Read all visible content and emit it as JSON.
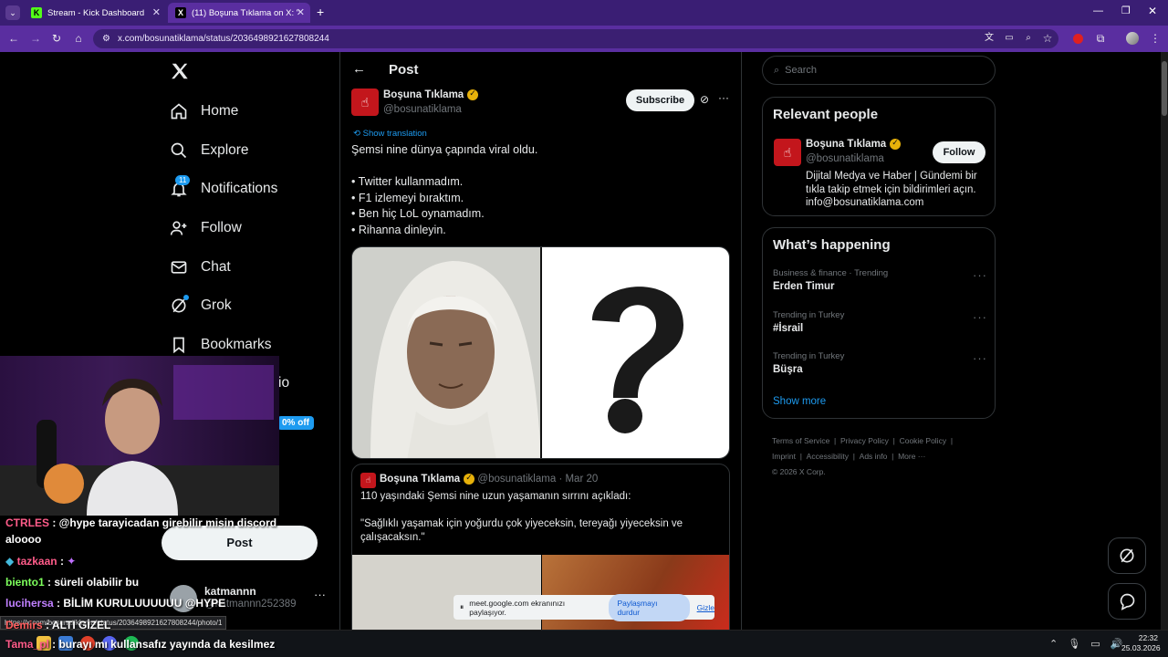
{
  "browser": {
    "tabs": [
      {
        "label": "Stream - Kick Dashboard",
        "favicon": "K"
      },
      {
        "label": "(11) Boşuna Tıklama on X: \"Şem",
        "favicon": "X"
      }
    ],
    "new_tab": "+",
    "url": "x.com/bosunatiklama/status/2036498921627808244"
  },
  "sidebar": {
    "items": [
      {
        "label": "Home",
        "icon": "home-icon"
      },
      {
        "label": "Explore",
        "icon": "search-icon"
      },
      {
        "label": "Notifications",
        "icon": "bell-icon",
        "badge": "11"
      },
      {
        "label": "Follow",
        "icon": "follow-icon"
      },
      {
        "label": "Chat",
        "icon": "mail-icon"
      },
      {
        "label": "Grok",
        "icon": "grok-icon"
      },
      {
        "label": "Bookmarks",
        "icon": "bookmark-icon"
      }
    ],
    "partial_label": "io",
    "partial_badge": "0% off",
    "post_button": "Post",
    "account": {
      "name": "katmannn",
      "handle": "@katmannn252389"
    }
  },
  "post": {
    "header": "Post",
    "author": "Boşuna Tıklama",
    "handle": "@bosunatiklama",
    "subscribe": "Subscribe",
    "show_translation": "Show translation",
    "lines": [
      "Şemsi nine dünya çapında viral oldu.",
      "",
      "• Twitter kullanmadım.",
      "• F1 izlemeyi bıraktım.",
      "• Ben hiç LoL oynamadım.",
      "• Rihanna dinleyin."
    ],
    "quote": {
      "author": "Boşuna Tıklama",
      "handle": "@bosunatiklama",
      "date": "· Mar 20",
      "line1": "110 yaşındaki Şemsi nine uzun yaşamanın sırrını açıkladı:",
      "line2": "\"Sağlıklı yaşamak için yoğurdu çok yiyeceksin, tereyağı yiyeceksin ve",
      "line3": "çalışacaksın.\""
    }
  },
  "right": {
    "search_placeholder": "Search",
    "relevant_title": "Relevant people",
    "person": {
      "name": "Boşuna Tıklama",
      "handle": "@bosunatiklama",
      "follow": "Follow",
      "bio1": "Dijital Medya ve Haber | Gündemi bir",
      "bio2": "tıkla takip etmek için bildirimleri açın.",
      "bio3": "info@bosunatiklama.com"
    },
    "happening_title": "What’s happening",
    "trends": [
      {
        "category": "Business & finance · Trending",
        "name": "Erden Timur"
      },
      {
        "category": "Trending in Turkey",
        "name": "#İsrail"
      },
      {
        "category": "Trending in Turkey",
        "name": "Büşra"
      }
    ],
    "show_more": "Show more",
    "footer": {
      "row1": [
        "Terms of Service",
        "|",
        "Privacy Policy",
        "|",
        "Cookie Policy",
        "|"
      ],
      "row2": [
        "Imprint",
        "|",
        "Accessibility",
        "|",
        "Ads info",
        "|",
        "More ···"
      ],
      "copyright": "© 2026 X Corp."
    }
  },
  "overlay": {
    "chat": [
      {
        "user": "CTRLES",
        "color": "#ff5c8a",
        "text": ": @hype tarayicadan girebilir misin discord"
      },
      {
        "user": "",
        "color": "#ffffff",
        "text": "aloooo"
      },
      {
        "user": "tazkaan",
        "color": "#ff5c8a",
        "text": ":"
      },
      {
        "user": "biento1",
        "color": "#7dff5c",
        "text": ": süreli olabilir bu"
      },
      {
        "user": "lucihersa",
        "color": "#c080ff",
        "text": ": BİLİM KURULUUUUUU @HYPE"
      },
      {
        "user": "Demirs",
        "color": "#ff5c5c",
        "text": ": ALTI GİZEL"
      },
      {
        "user": "Tama_pl",
        "color": "#ff5c8a",
        "text": ": burayı mı kullansafız yayında da kesilmez"
      }
    ],
    "status_url": "https://x.com/bosunatiklama/status/2036498921627808244/photo/1",
    "share_bar": {
      "text": "meet.google.com ekranınızı paylaşıyor.",
      "stop": "Paylaşmayı durdur",
      "hide": "Gizle"
    }
  },
  "taskbar": {
    "time": "22:32",
    "date": "25.03.2026"
  },
  "colors": {
    "accent": "#1d9bf0",
    "titlebar": "#3a1e74",
    "toolbar": "#5a2ea0",
    "verified": "#e7b10a",
    "brand_red": "#c3161c"
  }
}
